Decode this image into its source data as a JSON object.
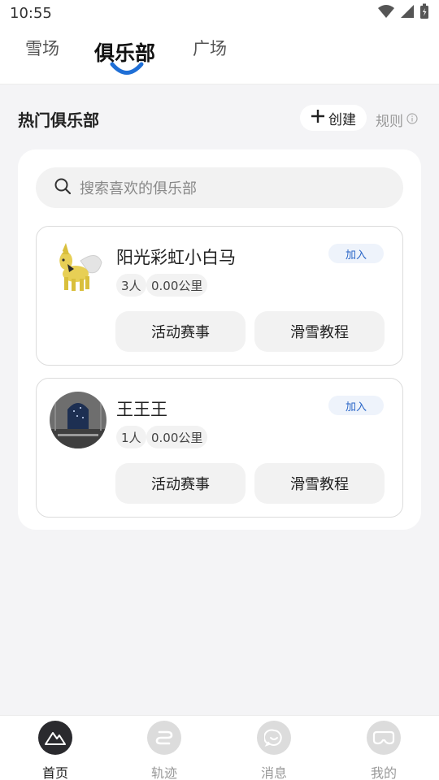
{
  "status_bar": {
    "time": "10:55",
    "icons": [
      "wifi-icon",
      "signal-icon",
      "battery-icon"
    ]
  },
  "tabs": [
    {
      "label": "雪场",
      "active": false
    },
    {
      "label": "俱乐部",
      "active": true
    },
    {
      "label": "广场",
      "active": false
    }
  ],
  "section": {
    "title": "热门俱乐部",
    "create_label": "创建",
    "rules_label": "规则"
  },
  "search": {
    "placeholder": "搜索喜欢的俱乐部"
  },
  "clubs": [
    {
      "name": "阳光彩虹小白马",
      "join_label": "加入",
      "members": "3人",
      "distance": "0.00公里",
      "actions": [
        "活动赛事",
        "滑雪教程"
      ]
    },
    {
      "name": "王王王",
      "join_label": "加入",
      "members": "1人",
      "distance": "0.00公里",
      "actions": [
        "活动赛事",
        "滑雪教程"
      ]
    }
  ],
  "bottom_nav": [
    {
      "label": "首页",
      "icon": "mountain-icon",
      "active": true
    },
    {
      "label": "轨迹",
      "icon": "track-icon",
      "active": false
    },
    {
      "label": "消息",
      "icon": "message-icon",
      "active": false
    },
    {
      "label": "我的",
      "icon": "goggles-icon",
      "active": false
    }
  ],
  "colors": {
    "accent": "#1f6fd6",
    "join_text": "#2a66c7",
    "background": "#f4f4f6"
  }
}
